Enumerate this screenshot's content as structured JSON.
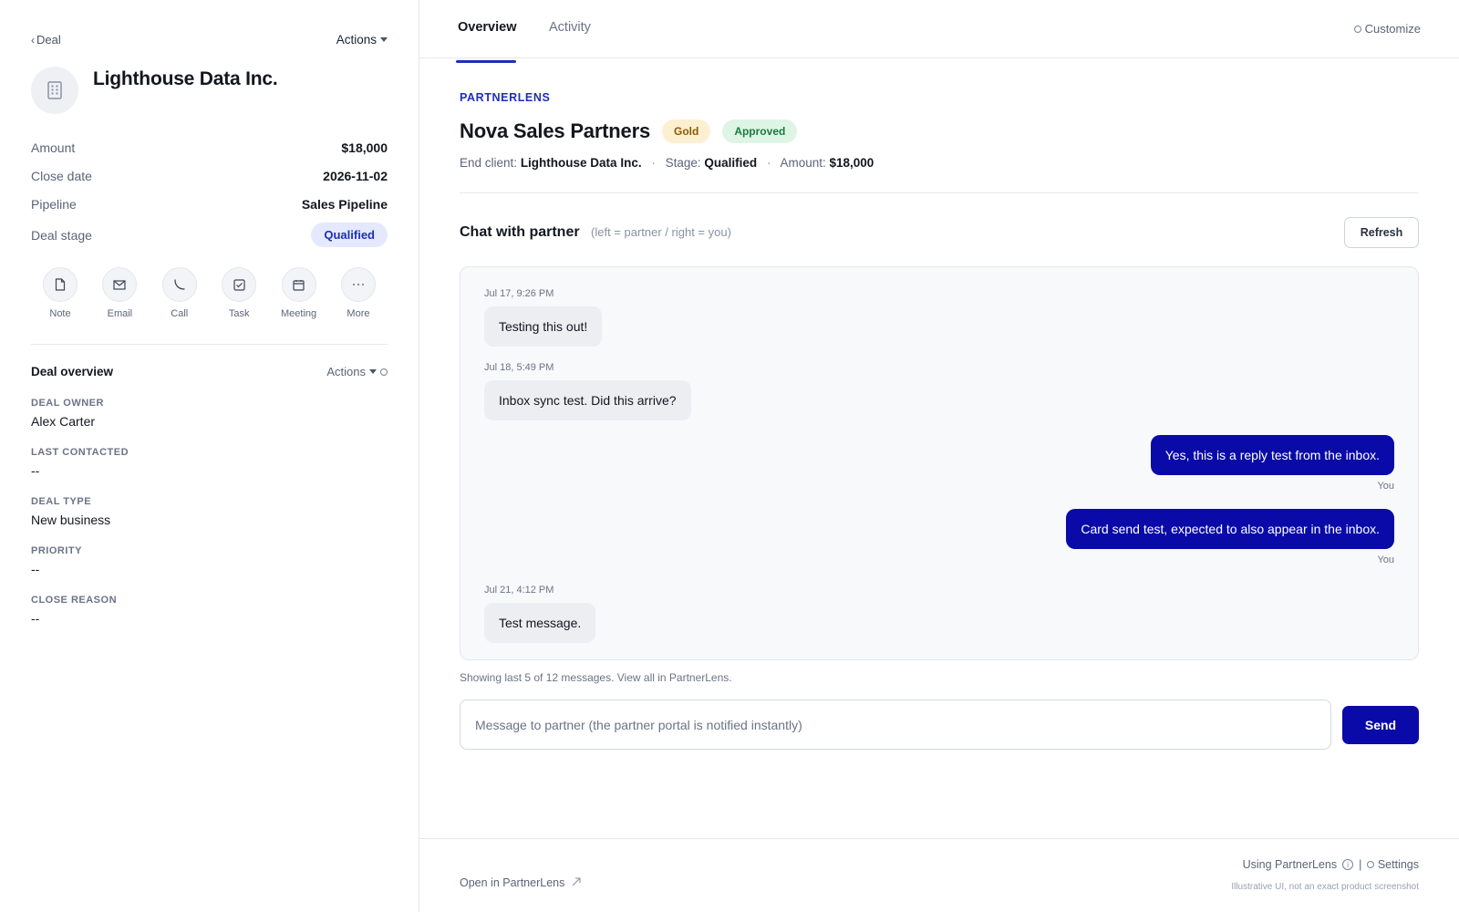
{
  "sidebar": {
    "back_label": "Deal",
    "actions_label": "Actions",
    "company_name": "Lighthouse Data Inc.",
    "properties": {
      "amount": {
        "label": "Amount",
        "value": "$18,000"
      },
      "close_date": {
        "label": "Close date",
        "value": "2026-11-02"
      },
      "pipeline": {
        "label": "Pipeline",
        "value": "Sales Pipeline"
      },
      "deal_stage": {
        "label": "Deal stage",
        "value": "Qualified"
      }
    },
    "quick_actions": [
      {
        "label": "Note",
        "icon": "note-icon"
      },
      {
        "label": "Email",
        "icon": "email-icon"
      },
      {
        "label": "Call",
        "icon": "phone-icon"
      },
      {
        "label": "Task",
        "icon": "task-icon"
      },
      {
        "label": "Meeting",
        "icon": "calendar-icon"
      },
      {
        "label": "More",
        "icon": "more-icon"
      }
    ],
    "overview": {
      "title": "Deal overview",
      "actions_label": "Actions",
      "fields": [
        {
          "label": "DEAL OWNER",
          "value": "Alex Carter"
        },
        {
          "label": "LAST CONTACTED",
          "value": "--"
        },
        {
          "label": "DEAL TYPE",
          "value": "New business"
        },
        {
          "label": "PRIORITY",
          "value": "--"
        },
        {
          "label": "CLOSE REASON",
          "value": "--"
        }
      ]
    }
  },
  "main": {
    "tabs": [
      {
        "label": "Overview",
        "active": true
      },
      {
        "label": "Activity",
        "active": false
      }
    ],
    "customize_label": "Customize",
    "brand": "PARTNERLENS",
    "partner_name": "Nova Sales Partners",
    "badges": {
      "tier": "Gold",
      "status": "Approved"
    },
    "meta": {
      "end_client_label": "End client:",
      "end_client": "Lighthouse Data Inc.",
      "stage_label": "Stage:",
      "stage": "Qualified",
      "amount_label": "Amount:",
      "amount": "$18,000",
      "separator": "·"
    },
    "chat": {
      "title": "Chat with partner",
      "hint": "(left = partner / right = you)",
      "refresh_label": "Refresh",
      "messages": [
        {
          "side": "partner",
          "timestamp": "Jul 17, 9:26 PM",
          "text": "Testing this out!"
        },
        {
          "side": "partner",
          "timestamp": "Jul 18, 5:49 PM",
          "text": "Inbox sync test. Did this arrive?"
        },
        {
          "side": "you",
          "text": "Yes, this is a reply test from the inbox.",
          "sender": "You"
        },
        {
          "side": "you",
          "text": "Card send test, expected to also appear in the inbox.",
          "sender": "You"
        },
        {
          "side": "partner",
          "timestamp": "Jul 21, 4:12 PM",
          "text": "Test message."
        }
      ],
      "showing_text": "Showing last 5 of 12 messages. View all in PartnerLens.",
      "input_placeholder": "Message to partner (the partner portal is notified instantly)",
      "input_value": "",
      "send_label": "Send"
    },
    "footer": {
      "open_link": "Open in PartnerLens",
      "using_label": "Using PartnerLens",
      "separator": "|",
      "settings_label": "Settings",
      "disclaimer": "Illustrative UI, not an exact product screenshot"
    }
  },
  "colors": {
    "accent": "#1f2fb6",
    "send_bubble": "#0a0aa8",
    "gold_bg": "#fdefd2",
    "approved_bg": "#def5e6"
  }
}
